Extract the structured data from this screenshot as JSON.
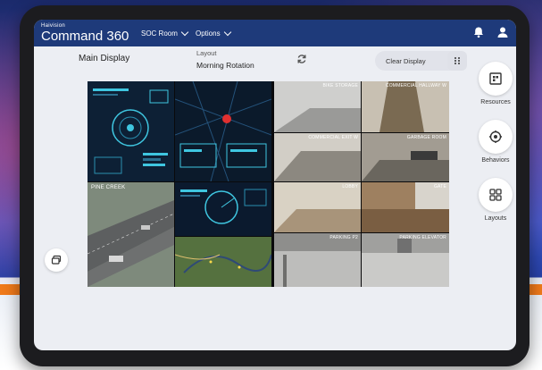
{
  "topbar": {
    "brand_small": "Haivision",
    "brand": "Command 360",
    "menus": [
      {
        "label": "SOC Room"
      },
      {
        "label": "Options"
      }
    ]
  },
  "toolbar": {
    "main_display": "Main Display",
    "layout_label": "Layout",
    "layout_name": "Morning Rotation",
    "clear_label": "Clear Display"
  },
  "wall": {
    "map_caption": "PINE CREEK",
    "cameras": [
      {
        "label": "BIKE STORAGE"
      },
      {
        "label": "COMMERCIAL HALLWAY W"
      },
      {
        "label": "COMMERCIAL EXIT W"
      },
      {
        "label": "GARBAGE ROOM"
      },
      {
        "label": "LOBBY"
      },
      {
        "label": "GATE"
      },
      {
        "label": "PARKING P2"
      },
      {
        "label": "PARKING ELEVATOR"
      }
    ]
  },
  "sidebar": {
    "items": [
      {
        "label": "Resources",
        "icon": "resources-icon"
      },
      {
        "label": "Behaviors",
        "icon": "behaviors-icon"
      },
      {
        "label": "Layouts",
        "icon": "layouts-icon"
      }
    ]
  },
  "colors": {
    "topbar": "#1e3a7a",
    "accent_orange": "#f07a1a",
    "background_blue": "#2b3fa0"
  }
}
